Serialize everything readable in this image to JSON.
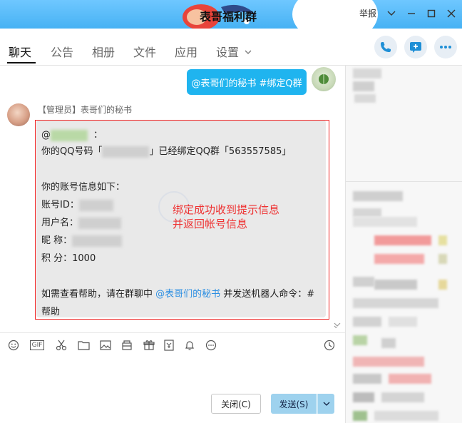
{
  "window": {
    "title": "表哥福利群",
    "report_label": "举报"
  },
  "tabs": [
    {
      "label": "聊天"
    },
    {
      "label": "公告"
    },
    {
      "label": "相册"
    },
    {
      "label": "文件"
    },
    {
      "label": "应用"
    },
    {
      "label": "设置"
    }
  ],
  "chat": {
    "my_message": "@表哥们的秘书 #绑定Q群",
    "sender_name": "【管理员】表哥们的秘书",
    "reply": {
      "at_prefix": "@",
      "at_suffix": "：",
      "qq_line_prefix": "你的QQ号码「",
      "qq_line_mid": "」已经绑定QQ群「563557585」",
      "account_header": "你的账号信息如下：",
      "account_id_label": "账号ID：",
      "username_label": "用户名：",
      "nickname_label": "昵  称：",
      "points_label": "积  分：1000",
      "help_prefix": "如需查看帮助，请在群聊中 ",
      "help_mention": "@表哥们的秘书",
      "help_suffix": " 并发送机器人命令：#",
      "help_tail": "帮助"
    },
    "annotation_line1": "绑定成功收到提示信息",
    "annotation_line2": "并返回帐号信息"
  },
  "toolbar": {
    "gif_label": "GIF",
    "icons": [
      "emoji-icon",
      "gif-icon",
      "scissors-icon",
      "folder-icon",
      "image-icon",
      "gift-box-icon",
      "gift-icon",
      "red-packet-icon",
      "bell-icon",
      "more-icon",
      "history-icon"
    ]
  },
  "buttons": {
    "close_label": "关闭(C)",
    "send_label": "发送(S)"
  },
  "colors": {
    "accent": "#1fb4ef",
    "annotation": "#e33333",
    "send_button": "#9ed2ee"
  }
}
